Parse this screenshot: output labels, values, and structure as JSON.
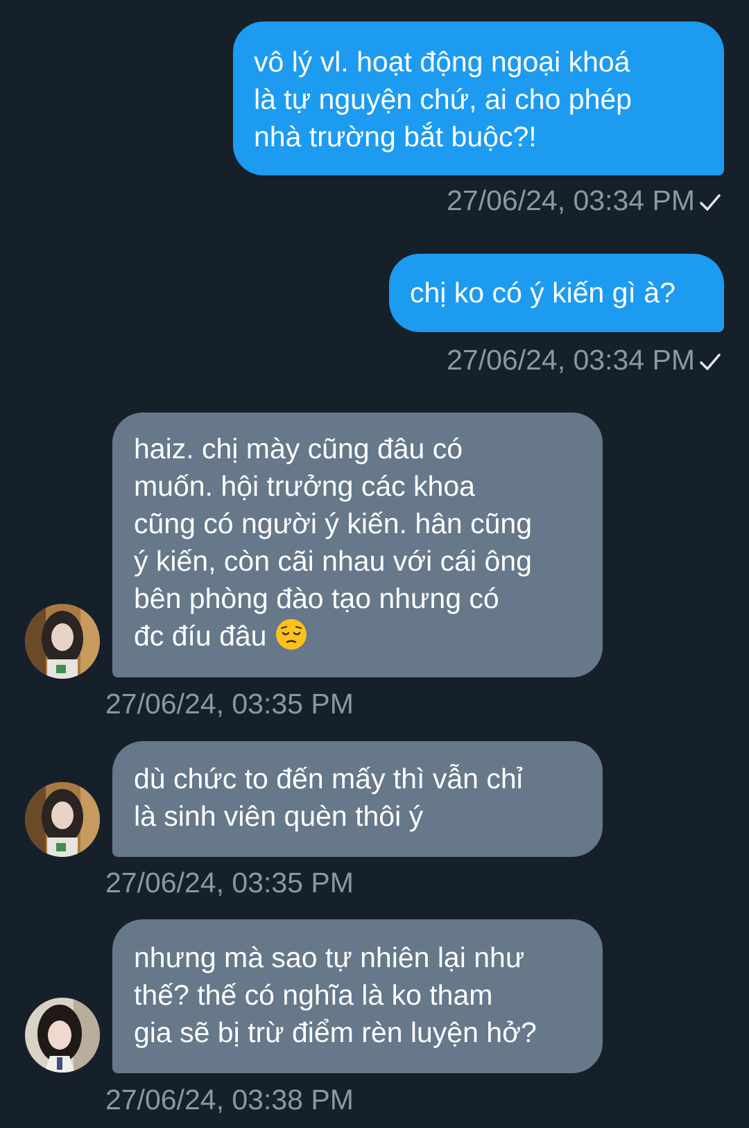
{
  "messages": [
    {
      "text": "vô lý vl. hoạt động ngoại khoá\nlà tự nguyện chứ, ai cho phép\nnhà trường bắt buộc?!",
      "time": "27/06/24, 03:34 PM"
    },
    {
      "text": "chị ko có ý kiến gì à?",
      "time": "27/06/24, 03:34 PM"
    },
    {
      "text": "haiz. chị mày cũng đâu có\nmuốn. hội trưởng các khoa\ncũng có người ý kiến. hân cũng\ný kiến, còn cãi nhau với cái ông\nbên phòng đào tạo nhưng có\nđc đíu đâu ",
      "emoji": "pensive-face-emoji",
      "time": "27/06/24, 03:35 PM"
    },
    {
      "text": "dù chức to đến mấy thì vẫn chỉ\nlà sinh viên quèn thôi ý",
      "time": "27/06/24, 03:35 PM"
    },
    {
      "text": "nhưng mà sao tự nhiên lại như\nthế? thế có nghĩa là ko tham\ngia sẽ bị trừ điểm rèn luyện hở?",
      "time": "27/06/24, 03:38 PM"
    }
  ],
  "colors": {
    "background": "#15202b",
    "sent_bubble": "#1d9bf0",
    "received_bubble": "#66788a",
    "timestamp": "#8899a6"
  },
  "icons": {
    "read_receipt": "check-icon",
    "avatar": "avatar"
  }
}
